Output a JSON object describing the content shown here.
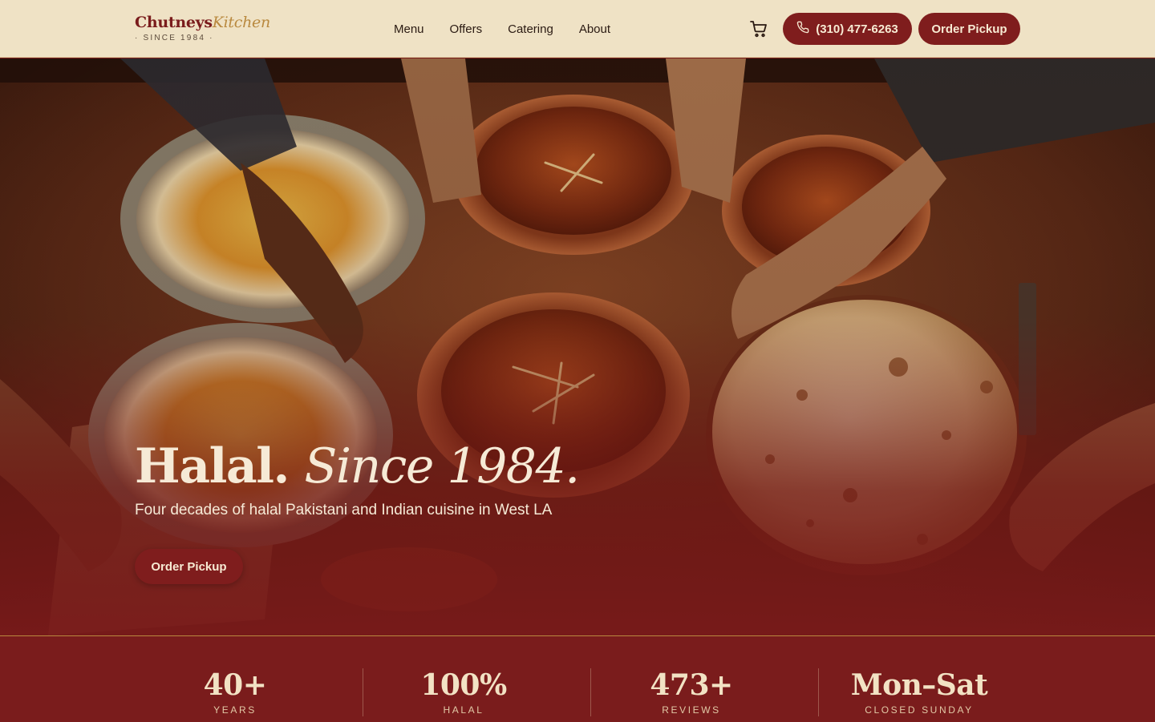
{
  "brand": {
    "name": "Chutneys",
    "name_accent": "Kitchen",
    "tagline": "· SINCE 1984 ·"
  },
  "nav": {
    "items": [
      {
        "label": "Menu"
      },
      {
        "label": "Offers"
      },
      {
        "label": "Catering"
      },
      {
        "label": "About"
      }
    ]
  },
  "header": {
    "cart_icon": "cart-icon",
    "phone_icon": "phone-icon",
    "phone_label": "(310) 477-6263",
    "order_label": "Order Pickup"
  },
  "hero": {
    "title_main": "Halal.",
    "title_italic": "Since 1984.",
    "subtitle": "Four decades of halal Pakistani and Indian cuisine in West LA",
    "cta_label": "Order Pickup"
  },
  "stats": [
    {
      "value": "40+",
      "label": "YEARS"
    },
    {
      "value": "100%",
      "label": "HALAL"
    },
    {
      "value": "473+",
      "label": "REVIEWS"
    },
    {
      "value": "Mon–Sat",
      "label": "CLOSED SUNDAY"
    }
  ],
  "colors": {
    "header_bg": "#efe2c5",
    "brand_red": "#7f1d1d",
    "gold": "#b9893f",
    "cream_text": "#f6ead6"
  }
}
